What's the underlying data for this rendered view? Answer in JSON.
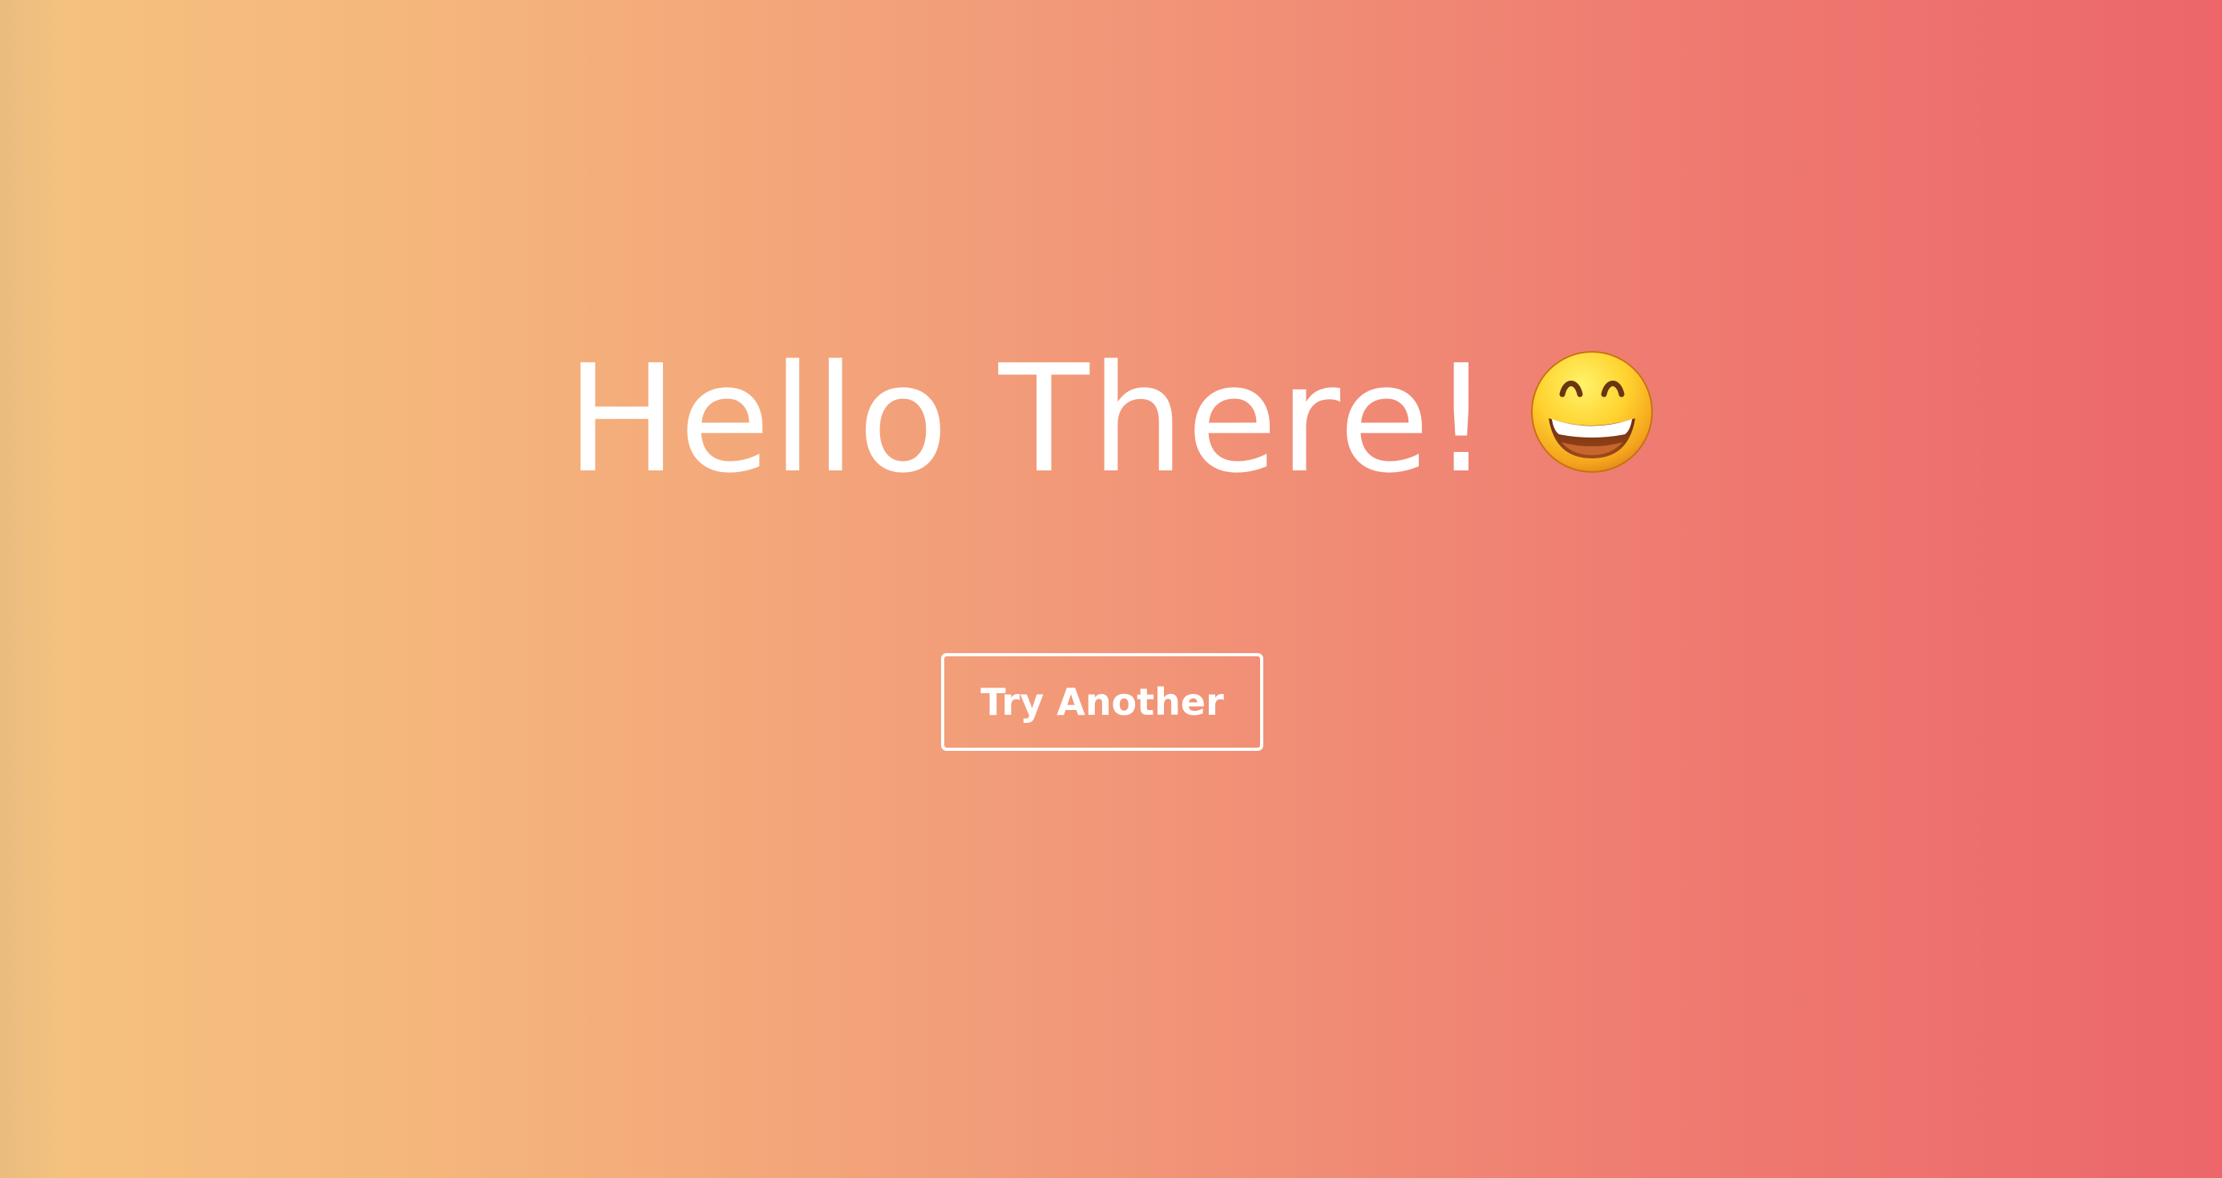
{
  "page": {
    "greeting": "Hello There!",
    "emoji": "grinning-face-with-smiling-eyes",
    "button_label": "Try Another"
  },
  "colors": {
    "gradient_start": "#f5c17e",
    "gradient_end": "#ec666a",
    "text": "#ffffff"
  }
}
